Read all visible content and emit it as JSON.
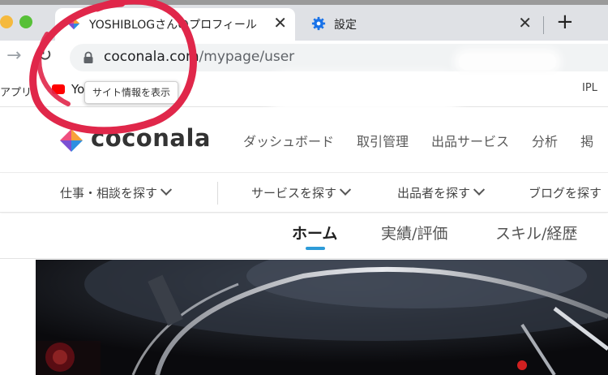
{
  "browser": {
    "tabs": [
      {
        "title": "YOSHIBLOGさんのプロフィール",
        "close": "✕",
        "active": true
      },
      {
        "title": "設定",
        "close": "✕",
        "active": false
      }
    ],
    "new_tab": "+",
    "url_host": "coconala.com",
    "url_path": "/mypage/user",
    "nav_forward": "→",
    "nav_reload": "↻"
  },
  "bookmarks": {
    "apps": "アプリ",
    "yo": "Yo",
    "right": "IPL"
  },
  "tooltip": "サイト情報を表示",
  "site": {
    "logo": "coconala",
    "topnav": [
      "ダッシュボード",
      "取引管理",
      "出品サービス",
      "分析",
      "掲"
    ],
    "subnav": [
      "仕事・相談を探す",
      "サービスを探す",
      "出品者を探す",
      "ブログを探す"
    ],
    "profile_tabs": [
      "ホーム",
      "実績/評価",
      "スキル/経歴"
    ]
  },
  "colors": {
    "annotation": "#e0274a",
    "accent": "#2d9bd8",
    "logo_pink": "#ef4f7f",
    "logo_orange": "#f8a13a",
    "logo_purple": "#7b4fd3",
    "logo_blue": "#2e8fe0"
  }
}
